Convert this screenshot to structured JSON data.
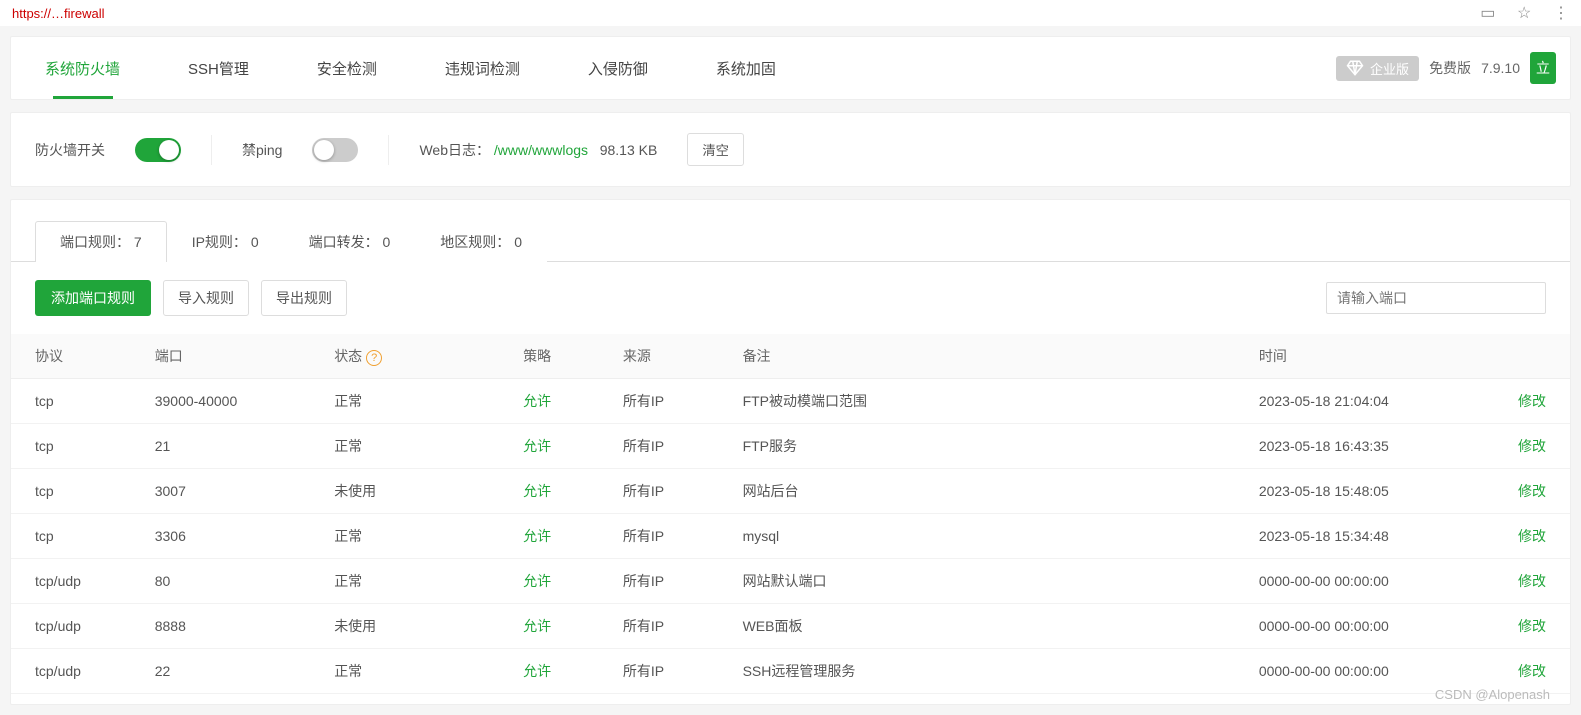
{
  "url": "https://…firewall",
  "nav": {
    "tabs": [
      "系统防火墙",
      "SSH管理",
      "安全检测",
      "违规词检测",
      "入侵防御",
      "系统加固"
    ],
    "active": 0,
    "enterprise": "企业版",
    "free": "免费版",
    "version": "7.9.10",
    "run": "立"
  },
  "panel": {
    "firewall_label": "防火墙开关",
    "ping_label": "禁ping",
    "weblog_label": "Web日志：",
    "weblog_path": "/www/wwwlogs",
    "weblog_size": "98.13 KB",
    "clear": "清空"
  },
  "subtabs": [
    {
      "label": "端口规则：",
      "count": "7"
    },
    {
      "label": "IP规则：",
      "count": "0"
    },
    {
      "label": "端口转发：",
      "count": "0"
    },
    {
      "label": "地区规则：",
      "count": "0"
    }
  ],
  "toolbar": {
    "add": "添加端口规则",
    "import": "导入规则",
    "export": "导出规则",
    "search_placeholder": "请输入端口"
  },
  "table": {
    "headers": {
      "protocol": "协议",
      "port": "端口",
      "status": "状态",
      "policy": "策略",
      "source": "来源",
      "note": "备注",
      "time": "时间",
      "action": "修改"
    },
    "rows": [
      {
        "protocol": "tcp",
        "port": "39000-40000",
        "status": "正常",
        "policy": "允许",
        "source": "所有IP",
        "note": "FTP被动模端口范围",
        "time": "2023-05-18 21:04:04"
      },
      {
        "protocol": "tcp",
        "port": "21",
        "status": "正常",
        "policy": "允许",
        "source": "所有IP",
        "note": "FTP服务",
        "time": "2023-05-18 16:43:35"
      },
      {
        "protocol": "tcp",
        "port": "3007",
        "status": "未使用",
        "policy": "允许",
        "source": "所有IP",
        "note": "网站后台",
        "time": "2023-05-18 15:48:05"
      },
      {
        "protocol": "tcp",
        "port": "3306",
        "status": "正常",
        "policy": "允许",
        "source": "所有IP",
        "note": "mysql",
        "time": "2023-05-18 15:34:48"
      },
      {
        "protocol": "tcp/udp",
        "port": "80",
        "status": "正常",
        "policy": "允许",
        "source": "所有IP",
        "note": "网站默认端口",
        "time": "0000-00-00 00:00:00"
      },
      {
        "protocol": "tcp/udp",
        "port": "8888",
        "status": "未使用",
        "policy": "允许",
        "source": "所有IP",
        "note": "WEB面板",
        "time": "0000-00-00 00:00:00"
      },
      {
        "protocol": "tcp/udp",
        "port": "22",
        "status": "正常",
        "policy": "允许",
        "source": "所有IP",
        "note": "SSH远程管理服务",
        "time": "0000-00-00 00:00:00"
      }
    ]
  },
  "watermark": "CSDN @Alopenash"
}
